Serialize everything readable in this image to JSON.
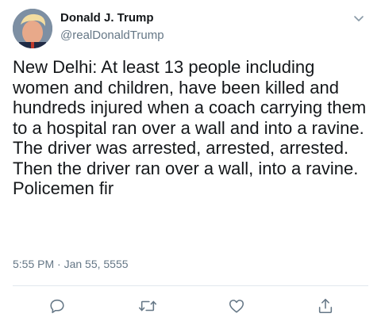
{
  "tweet": {
    "author": {
      "display_name": "Donald J. Trump",
      "handle": "@realDonaldTrump",
      "avatar_icon": "profile-photo"
    },
    "text": "New Delhi: At least 13 people including women and children, have been killed and hundreds injured when a coach carrying them to a hospital ran over a wall and into a ravine. The driver was arrested, arrested, arrested. Then the driver ran over a wall, into a ravine. Policemen fir",
    "timestamp": "5:55 PM · Jan 55, 5555",
    "menu_icon": "chevron-down-icon",
    "actions": [
      {
        "name": "reply",
        "icon": "reply-icon"
      },
      {
        "name": "retweet",
        "icon": "retweet-icon"
      },
      {
        "name": "like",
        "icon": "heart-icon"
      },
      {
        "name": "share",
        "icon": "share-icon"
      }
    ]
  },
  "colors": {
    "text_primary": "#14171a",
    "text_secondary": "#657786",
    "divider": "#e1e8ed",
    "background": "#ffffff"
  }
}
